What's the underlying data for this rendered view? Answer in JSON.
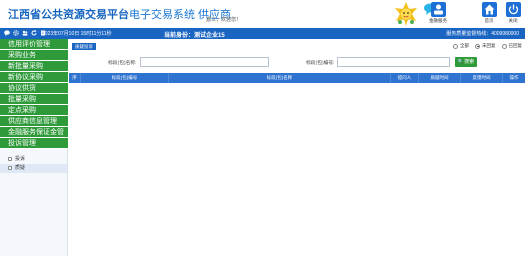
{
  "header": {
    "title_main": "江西省公共资源交易平台",
    "title_sub": "电子交易系统 供应商",
    "welcome": "嘉三，欢迎您！",
    "buttons": [
      {
        "label": "金融服务",
        "color": "#1d6fd6",
        "icon": "finance-icon"
      },
      {
        "label": "首页",
        "color": "#1d6fd6",
        "icon": "home-icon"
      },
      {
        "label": "关闭",
        "color": "#1d6fd6",
        "icon": "power-icon"
      }
    ]
  },
  "topbar": {
    "icons": [
      "chat-icon",
      "gear-icon",
      "users-icon",
      "refresh-icon",
      "doc-icon"
    ],
    "datetime": "2023年07月10日 15时11分11秒",
    "current_label": "当前身份：测试企业15",
    "hotline": "服务质量监督热线：4009980000"
  },
  "sidebar": {
    "menu": [
      "信用评价管理",
      "采购业务",
      "新批量采购",
      "新协议采购",
      "协议供货",
      "批量采购",
      "定点采购",
      "供应商信息管理",
      "金融服务保证金管",
      "投诉管理"
    ],
    "submenu": [
      {
        "label": "投诉",
        "active": false
      },
      {
        "label": "质疑",
        "active": true
      }
    ]
  },
  "content": {
    "tab": "质疑投诉",
    "radios": [
      {
        "label": "全部",
        "checked": false
      },
      {
        "label": "未回复",
        "checked": true
      },
      {
        "label": "已回复",
        "checked": false
      }
    ],
    "search": {
      "name_label": "标段(包)名称:",
      "name_value": "",
      "code_label": "标段(包)编号:",
      "code_value": "",
      "button": "搜索"
    },
    "columns": [
      "序",
      "标段(包)编号",
      "标段(包)名称",
      "提问人",
      "质疑时间",
      "反馈时间",
      "操作"
    ]
  }
}
